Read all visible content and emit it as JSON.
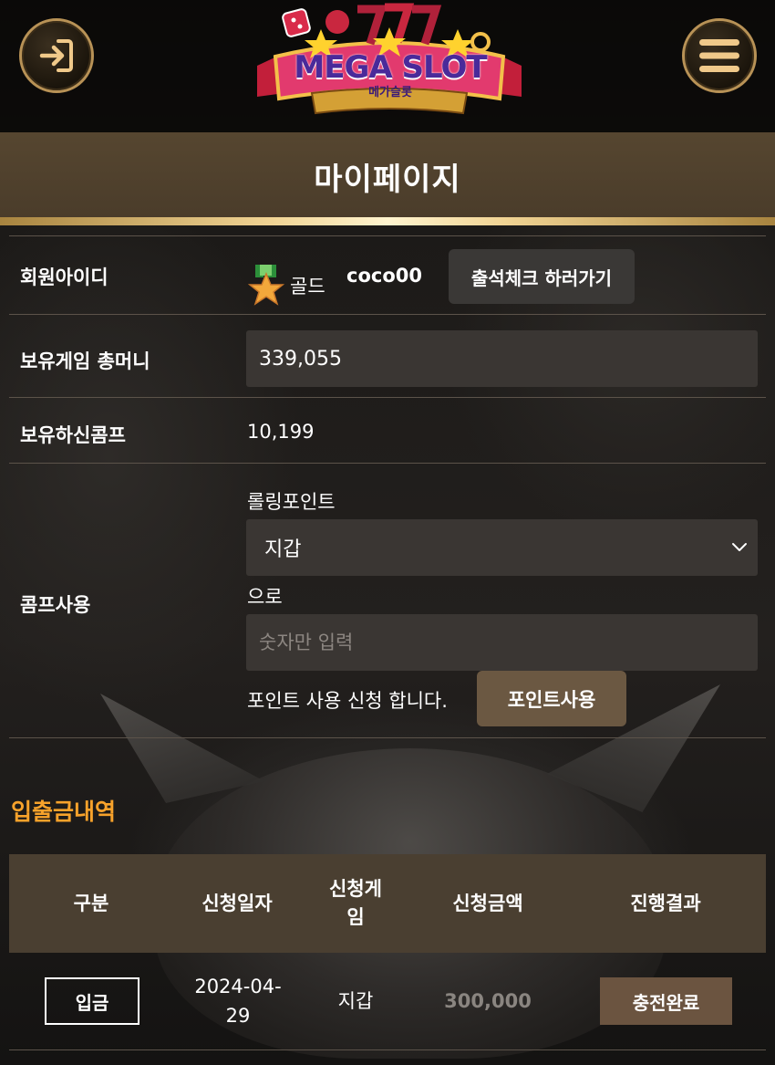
{
  "logo": {
    "main": "MEGA SLOT",
    "sub": "메가슬롯"
  },
  "page_title": "마이페이지",
  "member": {
    "id_label": "회원아이디",
    "grade": "골드",
    "user_id": "coco00",
    "attendance_button": "출석체크 하러가기"
  },
  "money": {
    "label": "보유게임 총머니",
    "value": "339,055"
  },
  "comp": {
    "label": "보유하신콤프",
    "value": "10,199"
  },
  "comp_use": {
    "label": "콤프사용",
    "source_text": "롤링포인트",
    "target_select": "지갑",
    "to_text": "으로",
    "amount_placeholder": "숫자만 입력",
    "request_text": "포인트 사용 신청 합니다.",
    "use_button": "포인트사용"
  },
  "history": {
    "title": "입출금내역",
    "columns": [
      "구분",
      "신청일자",
      "신청게임",
      "신청금액",
      "진행결과"
    ],
    "column_game_line1": "신청게",
    "column_game_line2": "임",
    "rows": [
      {
        "type": "입금",
        "date_line1": "2024-04-",
        "date_line2": "29",
        "game": "지갑",
        "amount": "300,000",
        "status": "충전완료"
      }
    ]
  },
  "colors": {
    "accent_gold": "#f1d494",
    "section_orange": "#f7a22b",
    "title_band": "#564630",
    "button_brown": "#6b5842"
  },
  "icons": {
    "login": "login-arrow-icon",
    "menu": "hamburger-menu-icon",
    "grade": "gold-star-medal-icon",
    "select": "chevron-down-icon"
  }
}
